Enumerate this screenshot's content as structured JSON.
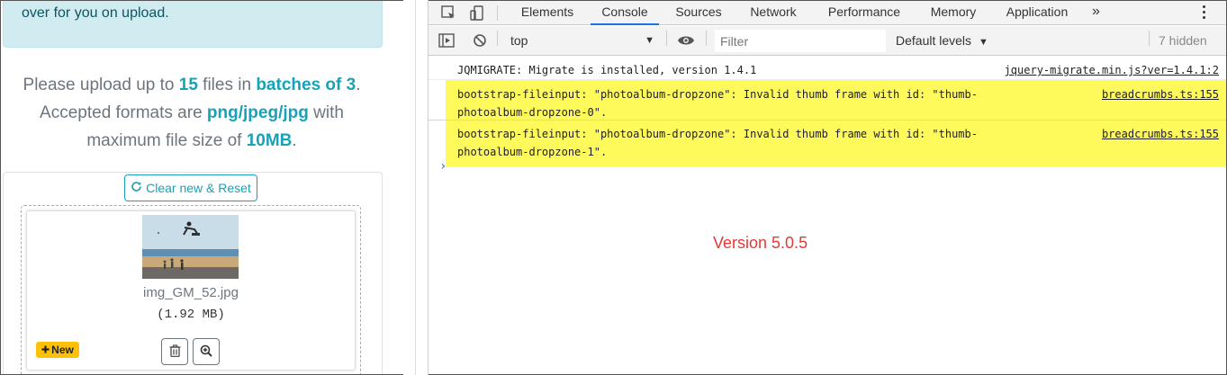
{
  "page": {
    "alert_text": "over for you on upload.",
    "upload_info": {
      "line1_prefix": "Please upload up to ",
      "max_files": "15",
      "line1_mid": " files in ",
      "batch_text": "batches of 3",
      "line1_end": ".",
      "line2_prefix": "Accepted formats are ",
      "formats": "png/jpeg/jpg",
      "line2_end": " with",
      "line3_prefix": "maximum file size of ",
      "max_size": "10MB",
      "line3_end": "."
    },
    "reset_button": "Clear new & Reset",
    "thumbnail": {
      "file_name": "img_GM_52.jpg",
      "file_size": "(1.92 MB)",
      "badge": "New"
    }
  },
  "devtools": {
    "tabs": [
      {
        "label": "Elements",
        "active": false
      },
      {
        "label": "Console",
        "active": true
      },
      {
        "label": "Sources",
        "active": false
      },
      {
        "label": "Network",
        "active": false
      },
      {
        "label": "Performance",
        "active": false
      },
      {
        "label": "Memory",
        "active": false
      },
      {
        "label": "Application",
        "active": false
      }
    ],
    "more_tabs": "»",
    "toolbar": {
      "context": "top",
      "filter_placeholder": "Filter",
      "levels": "Default levels",
      "hidden": "7 hidden"
    },
    "messages": [
      {
        "text": "JQMIGRATE: Migrate is installed, version 1.4.1",
        "source": "jquery-migrate.min.js?ver=1.4.1:2",
        "highlighted": false
      },
      {
        "text": "bootstrap-fileinput: \"photoalbum-dropzone\": Invalid thumb frame with id: \"thumb-\nphotoalbum-dropzone-0\".",
        "source": "breadcrumbs.ts:155",
        "highlighted": true
      },
      {
        "text": "bootstrap-fileinput: \"photoalbum-dropzone\": Invalid thumb frame with id: \"thumb-\nphotoalbum-dropzone-1\".",
        "source": "breadcrumbs.ts:155",
        "highlighted": true
      }
    ],
    "prompt_symbol": "›",
    "annotation": "Version 5.0.5"
  },
  "colors": {
    "accent_info": "#17a2b8",
    "highlight": "#fffa5c",
    "annotation": "#e53935",
    "active_tab": "#1a73e8",
    "badge": "#ffc107"
  }
}
